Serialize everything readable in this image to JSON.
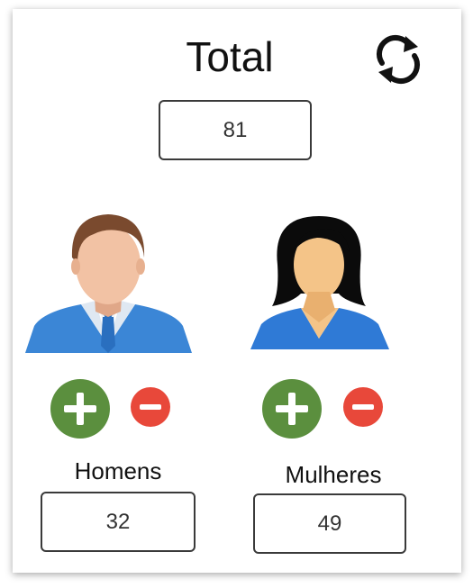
{
  "total": {
    "label": "Total",
    "value": "81"
  },
  "men": {
    "label": "Homens",
    "value": "32"
  },
  "women": {
    "label": "Mulheres",
    "value": "49"
  },
  "icons": {
    "refresh": "refresh-icon",
    "add": "plus-circle-icon",
    "remove": "minus-circle-icon",
    "men_avatar": "man-avatar-icon",
    "women_avatar": "woman-avatar-icon"
  },
  "colors": {
    "add_button": "#5b8f3e",
    "remove_button": "#e8483a",
    "shirt": "#3b86d6"
  }
}
